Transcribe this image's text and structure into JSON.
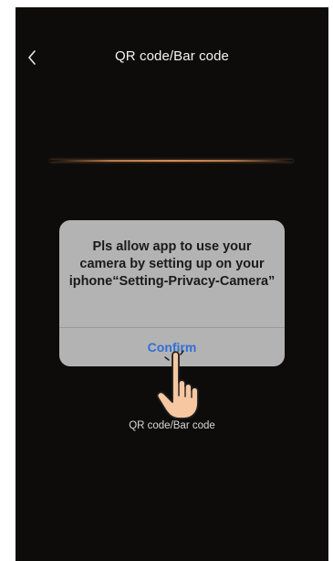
{
  "header": {
    "title": "QR code/Bar code",
    "back_icon": "chevron-left-icon"
  },
  "scanner": {
    "scan_line_color": "#d08a52",
    "caption": "QR code/Bar code"
  },
  "alert": {
    "message": "Pls allow app to use your camera by setting up on your iphone“Setting-Privacy-Camera”",
    "confirm_label": "Confirm",
    "confirm_color": "#2f6fd8",
    "background": "#b3b3b3"
  },
  "overlay": {
    "pointer_icon": "tap-hand-icon"
  }
}
